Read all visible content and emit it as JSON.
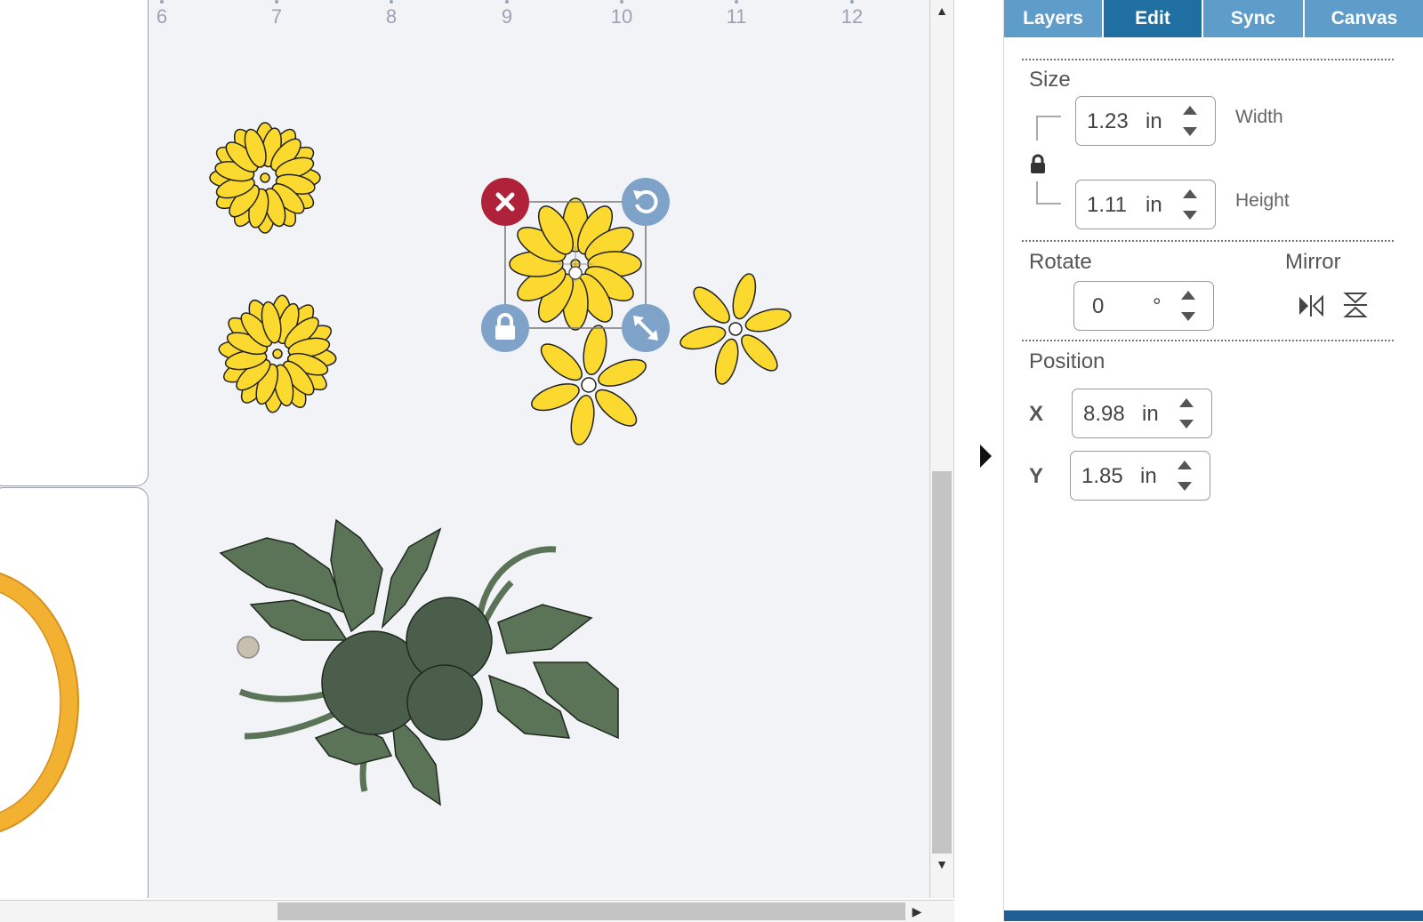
{
  "ruler": {
    "labels": [
      "6",
      "7",
      "8",
      "9",
      "10",
      "11",
      "12"
    ]
  },
  "tabs": [
    {
      "label": "Layers",
      "active": false
    },
    {
      "label": "Edit",
      "active": true
    },
    {
      "label": "Sync",
      "active": false
    },
    {
      "label": "Canvas",
      "active": false
    }
  ],
  "size": {
    "title": "Size",
    "width": {
      "value": "1.23",
      "unit": "in",
      "label": "Width"
    },
    "height": {
      "value": "1.11",
      "unit": "in",
      "label": "Height"
    },
    "lock_icon": "lock-icon"
  },
  "rotate": {
    "title": "Rotate",
    "value": "0",
    "unit": "°"
  },
  "mirror": {
    "title": "Mirror",
    "horizontal_icon": "mirror-horizontal-icon",
    "vertical_icon": "mirror-vertical-icon"
  },
  "position": {
    "title": "Position",
    "x": {
      "label": "X",
      "value": "8.98",
      "unit": "in"
    },
    "y": {
      "label": "Y",
      "value": "1.85",
      "unit": "in"
    }
  },
  "handles": {
    "delete_icon": "close-icon",
    "rotate_icon": "rotate-icon",
    "lock_icon": "lock-icon",
    "resize_icon": "resize-icon"
  },
  "colors": {
    "flower": "#fbd92f",
    "leaves": "#5b7357",
    "leaf_center": "#4a5e4b",
    "frame": "#f2b130",
    "handle_red": "#b0223a",
    "handle_blue": "#7fa3c8",
    "tab_active": "#1f6fa3",
    "tab": "#5e9cc9"
  }
}
